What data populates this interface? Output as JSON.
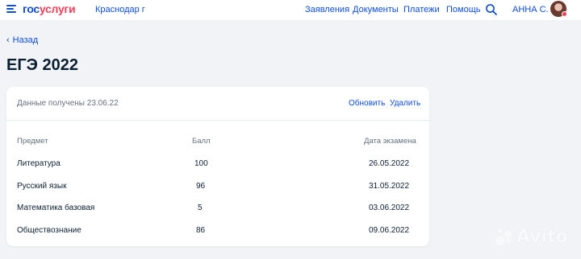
{
  "header": {
    "logo_part1": "гос",
    "logo_part2": "услуги",
    "region": "Краснодар г",
    "nav": [
      "Заявления",
      "Документы",
      "Платежи",
      "Помощь"
    ],
    "user": "АННА С."
  },
  "breadcrumb": {
    "back": "Назад"
  },
  "page": {
    "title": "ЕГЭ 2022"
  },
  "card": {
    "received": "Данные получены 23.06.22",
    "refresh": "Обновить",
    "delete": "Удалить"
  },
  "table": {
    "headers": [
      "Предмет",
      "Балл",
      "Дата экзамена"
    ],
    "rows": [
      [
        "Литература",
        "100",
        "26.05.2022"
      ],
      [
        "Русский язык",
        "96",
        "31.05.2022"
      ],
      [
        "Математика базовая",
        "5",
        "03.06.2022"
      ],
      [
        "Обществознание",
        "86",
        "09.06.2022"
      ]
    ]
  },
  "watermark": {
    "text": "Avito"
  },
  "colors": {
    "link": "#0d4cd3",
    "brand_red": "#ee3f58",
    "text": "#0b1f33",
    "muted": "#66727f",
    "background": "#f1f3f6"
  }
}
